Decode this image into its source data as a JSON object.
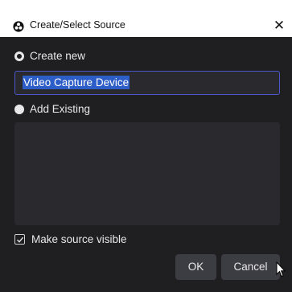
{
  "window": {
    "title": "Create/Select Source",
    "app_icon": "obs-logo-icon",
    "close_glyph": "✕"
  },
  "create_new": {
    "label": "Create new",
    "selected": true
  },
  "name_input": {
    "value": "Video Capture Device",
    "text_selected": true
  },
  "add_existing": {
    "label": "Add Existing",
    "selected": false
  },
  "existing_list": {
    "items": []
  },
  "visible_checkbox": {
    "label": "Make source visible",
    "checked": true
  },
  "buttons": {
    "ok": "OK",
    "cancel": "Cancel"
  },
  "colors": {
    "background": "#1f1f22",
    "input_bg": "#2a2a2e",
    "accent_border": "#4b57c9",
    "selection": "#2d5ec7",
    "button_bg": "#3c3c43"
  }
}
